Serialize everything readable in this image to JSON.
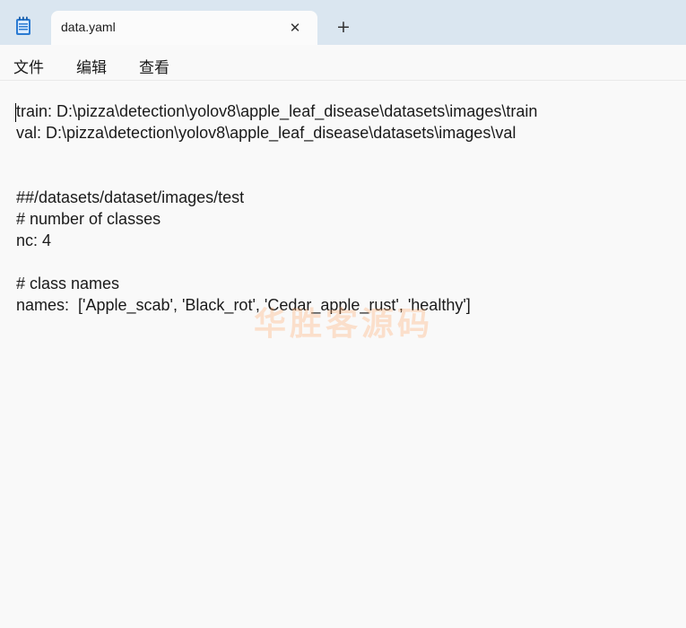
{
  "app": {
    "icon": "notepad-icon",
    "tab_title": "data.yaml",
    "close_icon": "close-icon",
    "new_tab_icon": "plus-icon"
  },
  "menu": {
    "items": [
      "文件",
      "编辑",
      "查看"
    ]
  },
  "editor": {
    "lines": [
      "train: D:\\pizza\\detection\\yolov8\\apple_leaf_disease\\datasets\\images\\train",
      "val: D:\\pizza\\detection\\yolov8\\apple_leaf_disease\\datasets\\images\\val",
      "",
      "",
      "##/datasets/dataset/images/test",
      "# number of classes",
      "nc: 4",
      "",
      "# class names",
      "names:  ['Apple_scab', 'Black_rot', 'Cedar_apple_rust', 'healthy']"
    ],
    "watermark": "华胜客源码"
  },
  "colors": {
    "titlebar_bg": "#dae6f0",
    "editor_bg": "#f9f9f9",
    "watermark": "#ffaa6e"
  }
}
